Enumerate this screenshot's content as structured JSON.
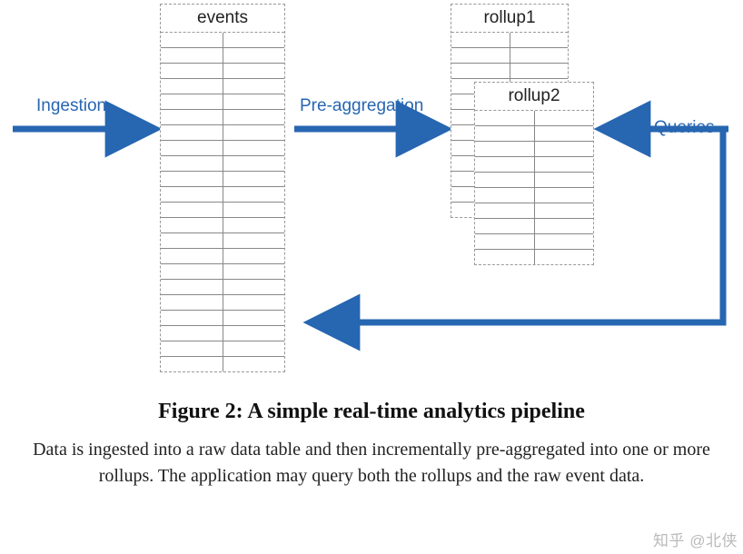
{
  "tables": {
    "events": {
      "header": "events",
      "rows": 22,
      "cols": 2
    },
    "rollup1": {
      "header": "rollup1",
      "rows": 12,
      "cols": 2
    },
    "rollup2": {
      "header": "rollup2",
      "rows": 10,
      "cols": 2
    }
  },
  "labels": {
    "ingestion": "Ingestion",
    "preaggregation": "Pre-aggregation",
    "queries": "Queries"
  },
  "caption": {
    "title": "Figure 2: A simple real-time analytics pipeline",
    "description": "Data is ingested into a raw data table and then incrementally pre-aggregated into one or more rollups. The application may query both the rollups and the raw event data."
  },
  "watermark": "知乎 @北侠",
  "colors": {
    "arrow": "#2766b1",
    "label": "#2766b1"
  }
}
